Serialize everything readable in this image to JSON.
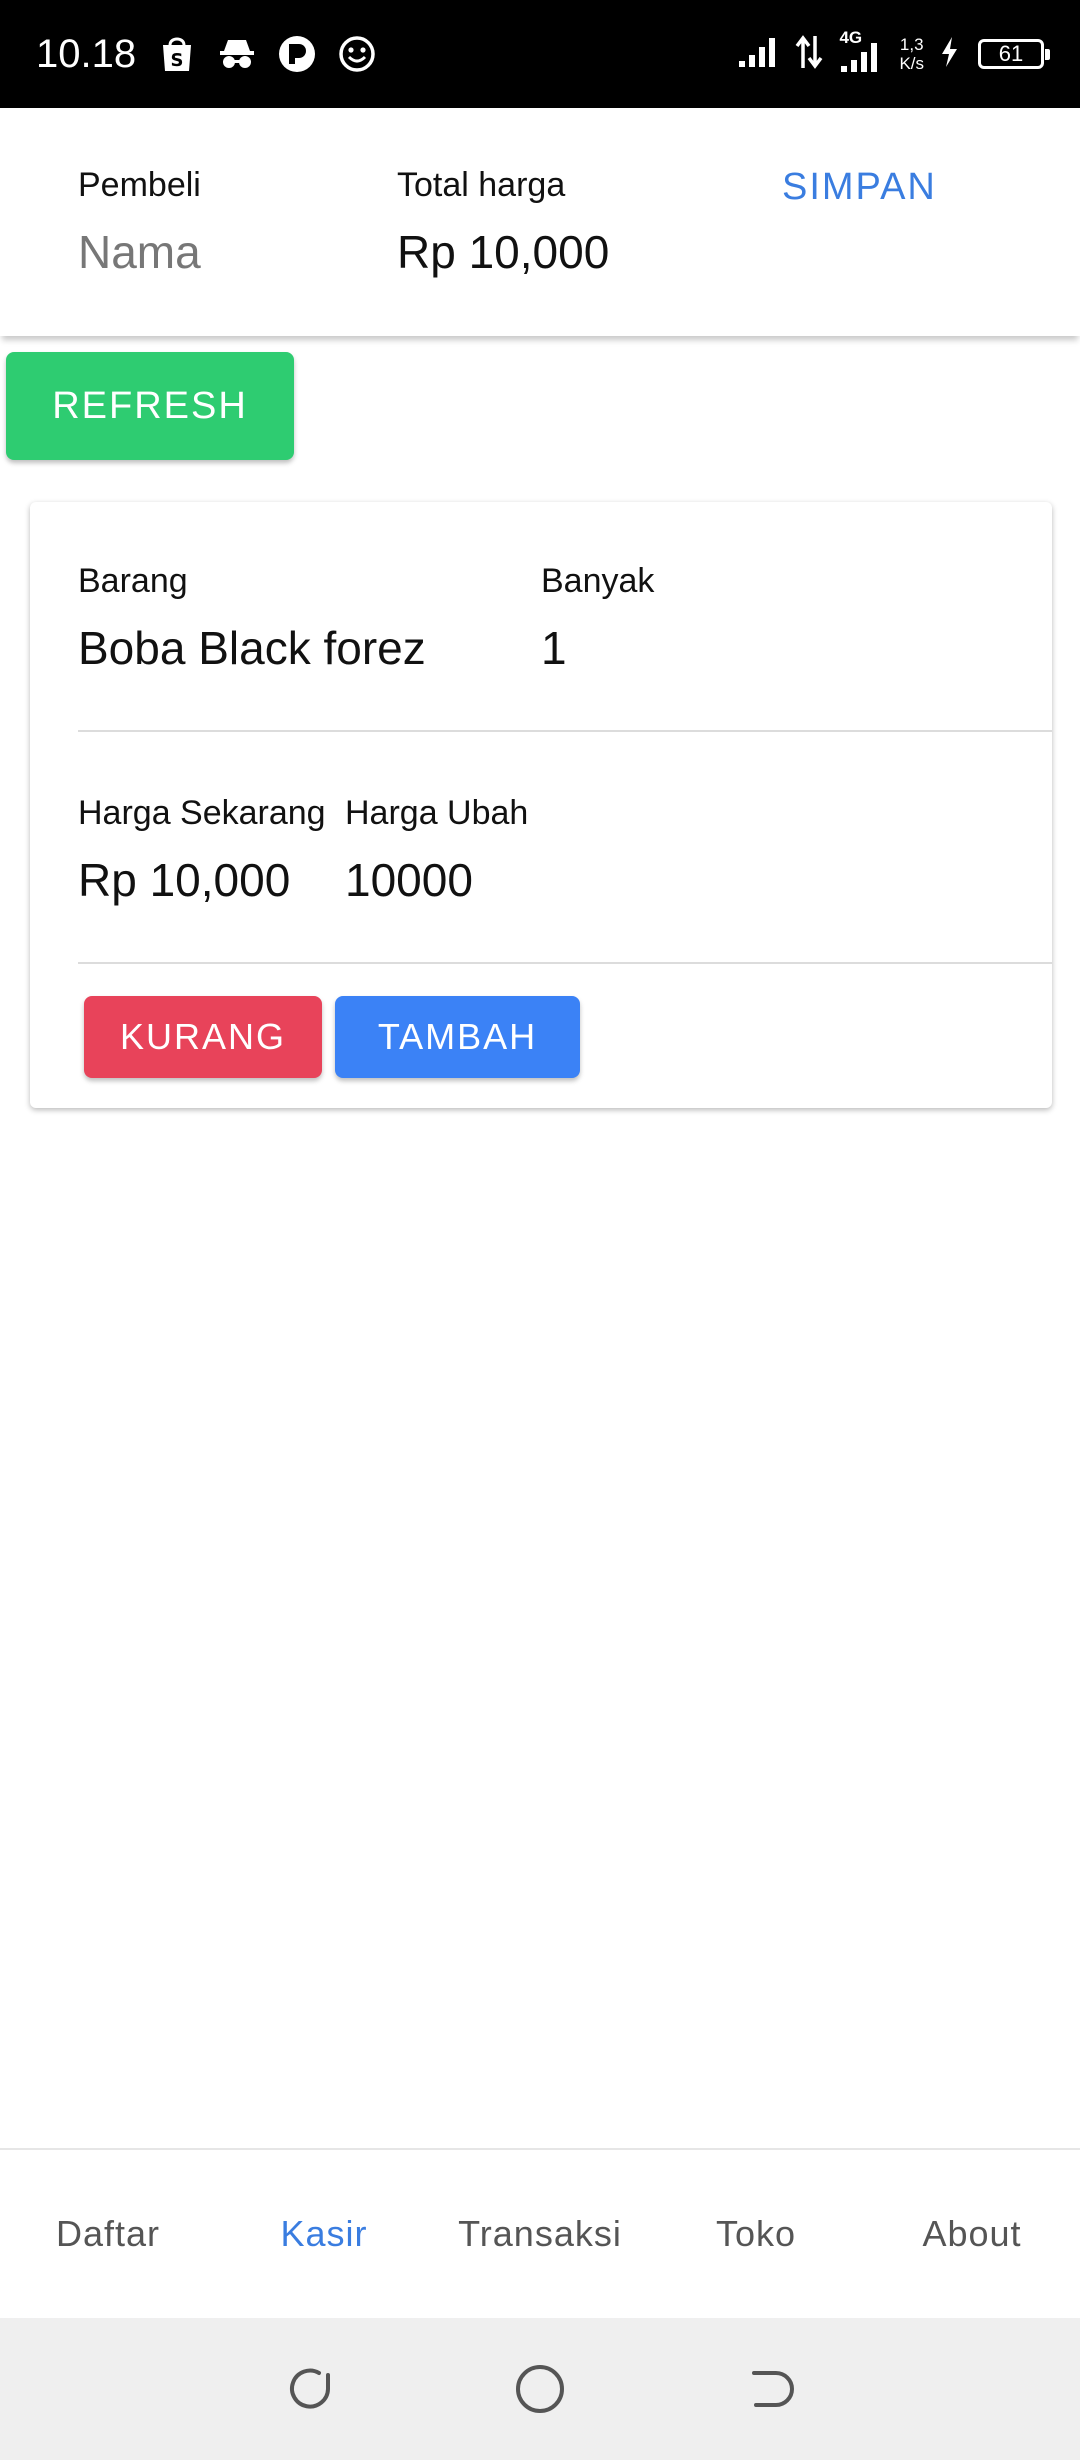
{
  "status_bar": {
    "time": "10.18",
    "net_type": "4G",
    "speed_value": "1,3",
    "speed_unit": "K/s",
    "battery": "61"
  },
  "header": {
    "buyer_label": "Pembeli",
    "buyer_placeholder": "Nama",
    "total_label": "Total harga",
    "total_value": "Rp 10,000",
    "save_label": "SIMPAN"
  },
  "refresh_label": "REFRESH",
  "item": {
    "item_label": "Barang",
    "item_value": "Boba Black forez",
    "qty_label": "Banyak",
    "qty_value": "1",
    "current_price_label": "Harga Sekarang",
    "current_price_value": "Rp 10,000",
    "changed_price_label": "Harga Ubah",
    "changed_price_value": "10000",
    "decrease_label": "KURANG",
    "increase_label": "TAMBAH"
  },
  "nav": {
    "items": [
      {
        "label": "Daftar"
      },
      {
        "label": "Kasir"
      },
      {
        "label": "Transaksi"
      },
      {
        "label": "Toko"
      },
      {
        "label": "About"
      }
    ],
    "active": "Kasir"
  },
  "colors": {
    "accent_blue": "#3a7de0",
    "refresh_green": "#2ecc71",
    "decrease_red": "#e8435a",
    "increase_blue": "#3b82f6"
  },
  "icons": {
    "status_left": [
      "shopee-bag-icon",
      "incognito-icon",
      "app-badge-icon",
      "smiley-icon"
    ],
    "status_right": [
      "signal-icon",
      "data-arrows-icon",
      "signal-4g-icon",
      "charging-icon",
      "battery-icon"
    ],
    "system_nav": [
      "recents-icon",
      "home-icon",
      "back-icon"
    ]
  }
}
